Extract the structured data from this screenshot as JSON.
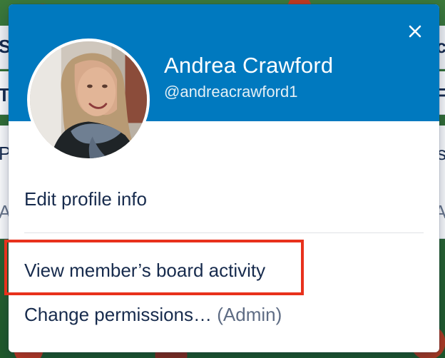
{
  "background": {
    "strip1": {
      "left": "S",
      "right": "c"
    },
    "strip2": {
      "left": "T",
      "right": "F"
    },
    "strip3": {
      "left": "P",
      "right": "s"
    },
    "strip4": {
      "left": "A",
      "right": "A"
    }
  },
  "popover": {
    "close_icon": "close-icon",
    "member": {
      "name": "Andrea Crawford",
      "username": "@andreacrawford1"
    },
    "menu": {
      "edit_profile": "Edit profile info",
      "view_activity": "View member’s board activity",
      "change_permissions": "Change permissions…",
      "change_permissions_suffix": "(Admin)"
    }
  },
  "colors": {
    "header_blue": "#0079bf",
    "highlight_red": "#e8311c",
    "text_dark": "#172b4d"
  }
}
